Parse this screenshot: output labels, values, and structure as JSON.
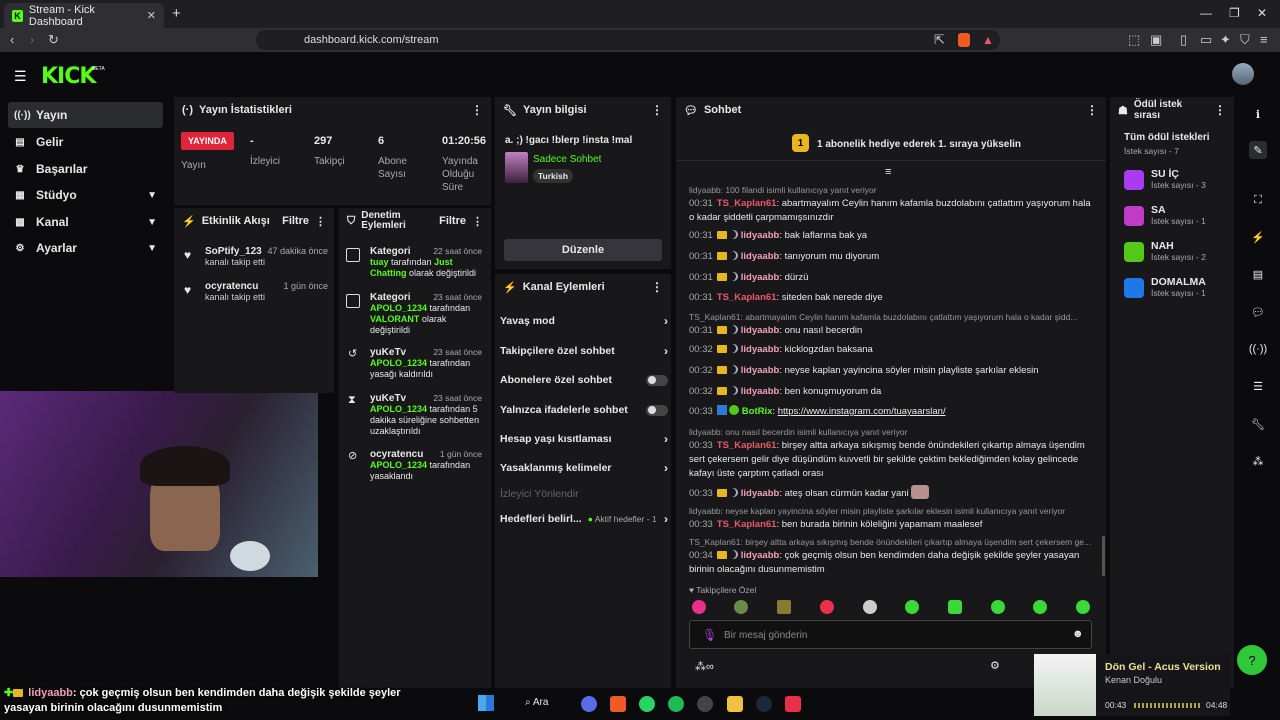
{
  "browser": {
    "tab_title": "Stream - Kick Dashboard",
    "url": "dashboard.kick.com/stream"
  },
  "header": {
    "logo": "KICK",
    "beta": "BETA"
  },
  "sidebar": {
    "items": [
      {
        "label": "Yayın",
        "icon": "broadcast-icon"
      },
      {
        "label": "Gelir",
        "icon": "revenue-icon"
      },
      {
        "label": "Başarılar",
        "icon": "trophy-icon"
      },
      {
        "label": "Stüdyo",
        "icon": "studio-icon"
      },
      {
        "label": "Kanal",
        "icon": "channel-icon"
      },
      {
        "label": "Ayarlar",
        "icon": "gear-icon"
      }
    ]
  },
  "stats": {
    "title": "Yayın İstatistikleri",
    "live_badge": "YAYINDA",
    "live_label": "Yayın",
    "items": [
      {
        "value": "-",
        "label": "İzleyici"
      },
      {
        "value": "297",
        "label": "Takipçi"
      },
      {
        "value": "6",
        "label": "Abone Sayısı"
      },
      {
        "value": "01:20:56",
        "label": "Yayında Olduğu Süre"
      }
    ]
  },
  "activity": {
    "title": "Etkinlik Akışı",
    "filter": "Filtre",
    "items": [
      {
        "name": "SoPtify_123",
        "time": "47 dakika önce",
        "text": "kanalı takip etti"
      },
      {
        "name": "ocyratencu",
        "time": "1 gün önce",
        "text": "kanalı takip etti"
      }
    ]
  },
  "moderation": {
    "title_1": "Denetim",
    "title_2": "Eylemleri",
    "filter": "Filtre",
    "items": [
      {
        "title": "Kategori",
        "time": "22 saat önce",
        "user": "tuay",
        "mid": "tarafından",
        "extra": "Just Chatting",
        "end": "olarak değiştirildi"
      },
      {
        "title": "Kategori",
        "time": "23 saat önce",
        "user": "APOLO_1234",
        "mid": "tarafından",
        "extra": "VALORANT",
        "end": "olarak değiştirildi"
      },
      {
        "title": "yuKeTv",
        "time": "23 saat önce",
        "user": "APOLO_1234",
        "mid": "tarafından",
        "extra": "",
        "end": "yasağı kaldırıldı"
      },
      {
        "title": "yuKeTv",
        "time": "23 saat önce",
        "user": "APOLO_1234",
        "mid": "tarafından 5 dakika süreliğine sohbetten uzaklaştırıldı",
        "extra": "",
        "end": ""
      },
      {
        "title": "ocyratencu",
        "time": "1 gün önce",
        "user": "APOLO_1234",
        "mid": "tarafından yasaklandı",
        "extra": "",
        "end": ""
      }
    ]
  },
  "stream_info": {
    "title": "Yayın bilgisi",
    "stream_title": "a. ;) !gacı !blerp !insta !mal",
    "category": "Sadece Sohbet",
    "tag": "Turkish",
    "edit_button": "Düzenle"
  },
  "channel_actions": {
    "title": "Kanal Eylemleri",
    "items": [
      {
        "label": "Yavaş mod",
        "type": "arrow"
      },
      {
        "label": "Takipçilere özel sohbet",
        "type": "arrow"
      },
      {
        "label": "Abonelere özel sohbet",
        "type": "toggle"
      },
      {
        "label": "Yalnızca ifadelerle sohbet",
        "type": "toggle"
      },
      {
        "label": "Hesap yaşı kısıtlaması",
        "type": "arrow"
      },
      {
        "label": "Yasaklanmış kelimeler",
        "type": "arrow"
      }
    ],
    "disabled": "İzleyici Yönlendir",
    "goals_label": "Hedefleri belirl...",
    "goals_status": "Aktif hedefler - 1"
  },
  "chat": {
    "title": "Sohbet",
    "pinned_number": "1",
    "pinned_text": "1 abonelik hediye ederek 1. sıraya yükselin",
    "followers_only": "Takipçilere Özel",
    "placeholder": "Bir mesaj gönderin",
    "messages": [
      {
        "reply": "lidyaabb: 100 filandi isimli kullanıcıya yanıt veriyor",
        "time": "00:31",
        "user": "TS_Kaplan61",
        "text": "abartmayalım Ceylin hanım kafamla buzdolabını çatlattım yaşıyorum hala o kadar şiddetli çarpmamışsınızdır",
        "style": "ur"
      },
      {
        "time": "00:31",
        "user": "lidyaabb",
        "text": "bak laflarına bak ya",
        "style": "u"
      },
      {
        "time": "00:31",
        "user": "lidyaabb",
        "text": "tanıyorum mu diyorum",
        "style": "u"
      },
      {
        "time": "00:31",
        "user": "lidyaabb",
        "text": "dürzü",
        "style": "u"
      },
      {
        "time": "00:31",
        "user": "TS_Kaplan61",
        "text": "siteden bak nerede diye",
        "style": "ur"
      },
      {
        "reply": "TS_Kaplan61: abartmayalım Ceylin hanım kafamla buzdolabını çatlattım yaşıyorum hala o kadar şidd...",
        "time": "00:31",
        "user": "lidyaabb",
        "text": "onu nasıl becerdin",
        "style": "u"
      },
      {
        "time": "00:32",
        "user": "lidyaabb",
        "text": "kicklogzdan baksana",
        "style": "u"
      },
      {
        "time": "00:32",
        "user": "lidyaabb",
        "text": "neyse kaplan yayincina söyler misin playliste şarkılar eklesin",
        "style": "u"
      },
      {
        "time": "00:32",
        "user": "lidyaabb",
        "text": "ben konuşmuyorum da",
        "style": "u"
      },
      {
        "time": "00:33",
        "user": "BotRix",
        "text": "https://www.instagram.com/tuayaarslan/",
        "style": "ub"
      },
      {
        "reply": "lidyaabb: onu nasıl becerdin isimli kullanıcıya yanıt veriyor",
        "time": "00:33",
        "user": "TS_Kaplan61",
        "text": "birşey altta arkaya sıkışmış bende önündekileri çıkartıp almaya üşendim sert çekersem gelir diye düşündüm kuvvetli bir şekilde çektim beklediğimden kolay gelincede kafayı üste çarptım çatladı orası",
        "style": "ur"
      },
      {
        "time": "00:33",
        "user": "lidyaabb",
        "text": "ateş olsan cürmün kadar yani",
        "style": "u"
      },
      {
        "reply": "lidyaabb: neyse kaplan yayincina söyler misin playliste şarkılar eklesin isimli kullanıcıya yanıt veriyor",
        "time": "00:33",
        "user": "TS_Kaplan61",
        "text": "ben burada birinin köleliğini yapamam maalesef",
        "style": "ur"
      },
      {
        "reply": "TS_Kaplan61: birşey altta arkaya sıkışmış bende önündekileri çıkartıp almaya üşendim sert çekersem ge...",
        "time": "00:34",
        "user": "lidyaabb",
        "text": "çok geçmiş olsun ben kendimden daha değişik şekilde şeyler yasayan birinin olacağını dusunmemistim",
        "style": "u"
      }
    ]
  },
  "rewards": {
    "title": "Ödül istek sırası",
    "all": "Tüm ödül istekleri",
    "all_count": "İstek sayısı - 7",
    "items": [
      {
        "title": "SU İÇ",
        "count": "İstek sayısı - 3",
        "color": "#a83cf0"
      },
      {
        "title": "SA",
        "count": "İstek sayısı - 1",
        "color": "#c03cc8"
      },
      {
        "title": "NAH",
        "count": "İstek sayısı - 2",
        "color": "#53c818"
      },
      {
        "title": "DOMALMA",
        "count": "İstek sayısı - 1",
        "color": "#1e78e8"
      }
    ]
  },
  "overlay": {
    "caption_user": "lidyaabb",
    "caption_text": ": çok geçmiş olsun ben kendimden daha değişik şekilde şeyler yasayan birinin olacağını dusunmemistim"
  },
  "music": {
    "title": "Dön Gel - Acus Version",
    "artist": "Kenan Doğulu",
    "elapsed": "00:43",
    "total": "04:48"
  },
  "taskbar": {
    "search": "Ara"
  },
  "colors": {
    "accent": "#53fc18",
    "live": "#e0243a",
    "panel": "#18181b"
  }
}
